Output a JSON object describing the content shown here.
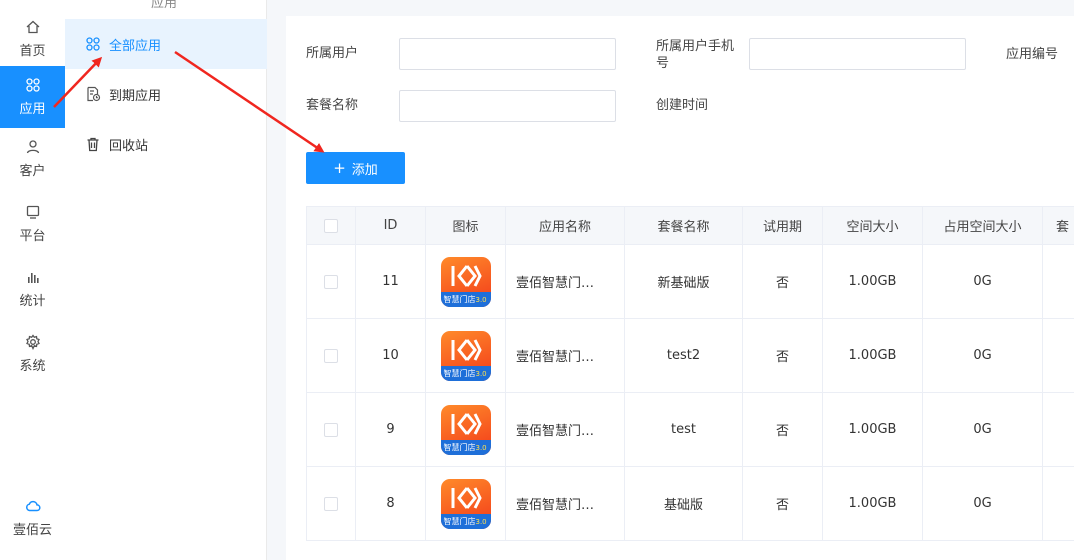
{
  "rail": {
    "items": [
      {
        "label": "首页",
        "icon": "home-icon"
      },
      {
        "label": "应用",
        "icon": "apps-icon",
        "active": true
      },
      {
        "label": "客户",
        "icon": "user-icon"
      },
      {
        "label": "平台",
        "icon": "monitor-icon"
      },
      {
        "label": "统计",
        "icon": "bar-chart-icon"
      },
      {
        "label": "系统",
        "icon": "gear-icon"
      }
    ],
    "brand": {
      "label": "壹佰云",
      "icon": "cloud-icon"
    }
  },
  "submenu": {
    "heading_cut": "应用",
    "items": [
      {
        "label": "全部应用",
        "icon": "apps-icon",
        "active": true
      },
      {
        "label": "到期应用",
        "icon": "expiry-doc-icon"
      },
      {
        "label": "回收站",
        "icon": "trash-icon"
      }
    ]
  },
  "filters": {
    "owner_user": "所属用户",
    "owner_phone": "所属用户手机号",
    "app_code": "应用编号",
    "plan_name": "套餐名称",
    "created_time": "创建时间"
  },
  "toolbar": {
    "add_label": "添加"
  },
  "table": {
    "headers": [
      "ID",
      "图标",
      "应用名称",
      "套餐名称",
      "试用期",
      "空间大小",
      "占用空间大小",
      "套"
    ],
    "icon_band_text": "智慧门店",
    "icon_band_version": "3.0",
    "rows": [
      {
        "id": "11",
        "name": "壹佰智慧门…",
        "plan": "新基础版",
        "trial": "否",
        "space": "1.00GB",
        "used": "0G"
      },
      {
        "id": "10",
        "name": "壹佰智慧门…",
        "plan": "test2",
        "trial": "否",
        "space": "1.00GB",
        "used": "0G"
      },
      {
        "id": "9",
        "name": "壹佰智慧门…",
        "plan": "test",
        "trial": "否",
        "space": "1.00GB",
        "used": "0G"
      },
      {
        "id": "8",
        "name": "壹佰智慧门…",
        "plan": "基础版",
        "trial": "否",
        "space": "1.00GB",
        "used": "0G"
      }
    ]
  },
  "colors": {
    "primary": "#1890ff",
    "annotation": "#f0261f",
    "app_icon_orange": "#ff6a1f",
    "app_icon_band": "#1e6fd9"
  }
}
